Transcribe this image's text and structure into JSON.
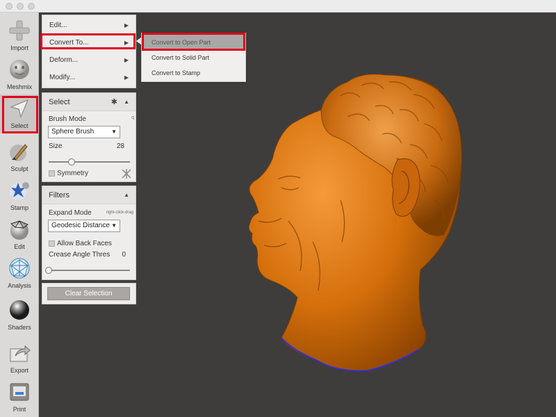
{
  "toolbar": {
    "items": [
      {
        "label": "Import",
        "icon": "plus-icon"
      },
      {
        "label": "Meshmix",
        "icon": "face-icon"
      },
      {
        "label": "Select",
        "icon": "cursor-arrow-icon",
        "active": true
      },
      {
        "label": "Sculpt",
        "icon": "brush-icon"
      },
      {
        "label": "Stamp",
        "icon": "stamp-icon"
      },
      {
        "label": "Edit",
        "icon": "mesh-edit-icon"
      },
      {
        "label": "Analysis",
        "icon": "analysis-icon"
      },
      {
        "label": "Shaders",
        "icon": "sphere-icon"
      },
      {
        "label": "Export",
        "icon": "export-icon"
      },
      {
        "label": "Print",
        "icon": "printer-icon"
      }
    ]
  },
  "edit_menu": {
    "items": [
      {
        "label": "Edit...",
        "arrow": "▶"
      },
      {
        "label": "Convert To...",
        "arrow": "▶"
      },
      {
        "label": "Deform...",
        "arrow": "▶"
      },
      {
        "label": "Modify...",
        "arrow": "▶"
      }
    ]
  },
  "convert_submenu": {
    "items": [
      {
        "label": "Convert to Open Part"
      },
      {
        "label": "Convert to Solid Part"
      },
      {
        "label": "Convert to Stamp"
      }
    ]
  },
  "select_panel": {
    "title": "Select",
    "brush_mode_label": "Brush Mode",
    "brush_mode_value": "Sphere Brush",
    "size_label": "Size",
    "size_value": "28",
    "size_fraction": 0.28,
    "symmetry_label": "Symmetry"
  },
  "filters_panel": {
    "title": "Filters",
    "expand_mode_label": "Expand Mode",
    "expand_mode_hint": "right-click-drag",
    "expand_mode_value": "Geodesic Distance",
    "allow_back_faces_label": "Allow Back Faces",
    "crease_angle_label": "Crease Angle Thres",
    "crease_angle_value": "0",
    "crease_fraction": 0
  },
  "clear_selection_label": "Clear Selection",
  "colors": {
    "viewport_bg": "#3e3d3c",
    "model_orange": "#d46f0b",
    "highlight_red": "#e0001b",
    "selection_boundary": "#2a2aff"
  }
}
